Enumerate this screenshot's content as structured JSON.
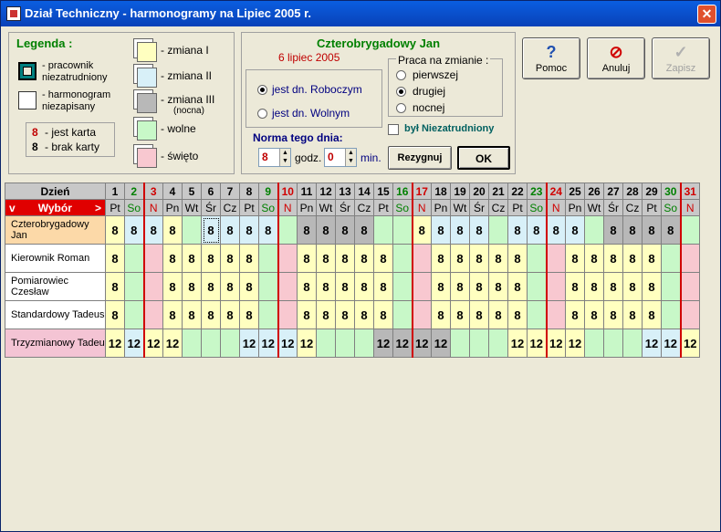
{
  "window": {
    "title": "Dział Techniczny - harmonogramy na Lipiec 2005 r."
  },
  "legend": {
    "title": "Legenda :",
    "employed_lbl1": "- pracownik",
    "employed_lbl2": "niezatrudniony",
    "unsched_lbl1": "- harmonogram",
    "unsched_lbl2": "niezapisany",
    "card_yes_num": "8",
    "card_yes_txt": "- jest karta",
    "card_no_num": "8",
    "card_no_txt": "- brak karty",
    "shift1": "- zmiana I",
    "shift2": "- zmiana II",
    "shift3": "- zmiana III",
    "shift3_sub": "(nocna)",
    "free": "- wolne",
    "holiday": "- święto"
  },
  "detail": {
    "name": "Czterobrygadowy Jan",
    "date": "6 lipiec 2005",
    "day_work": "jest dn. Roboczym",
    "day_free": "jest dn. Wolnym",
    "shift_group": "Praca na zmianie :",
    "shift_first": "pierwszej",
    "shift_second": "drugiej",
    "shift_night": "nocnej",
    "norm_label": "Norma tego dnia:",
    "hours_val": "8",
    "hours_lbl": "godz.",
    "min_val": "0",
    "min_lbl": "min.",
    "unemployed_lbl": "był Niezatrudniony",
    "cancel_btn": "Rezygnuj",
    "ok_btn": "OK"
  },
  "buttons": {
    "help": "Pomoc",
    "cancel": "Anuluj",
    "save": "Zapisz"
  },
  "grid": {
    "hdr_day": "Dzień",
    "hdr_select": "Wybór",
    "days": [
      {
        "n": "1",
        "d": "Pt",
        "t": "w"
      },
      {
        "n": "2",
        "d": "So",
        "t": "s"
      },
      {
        "n": "3",
        "d": "N",
        "t": "n"
      },
      {
        "n": "4",
        "d": "Pn",
        "t": "w"
      },
      {
        "n": "5",
        "d": "Wt",
        "t": "w"
      },
      {
        "n": "6",
        "d": "Śr",
        "t": "w"
      },
      {
        "n": "7",
        "d": "Cz",
        "t": "w"
      },
      {
        "n": "8",
        "d": "Pt",
        "t": "w"
      },
      {
        "n": "9",
        "d": "So",
        "t": "s"
      },
      {
        "n": "10",
        "d": "N",
        "t": "n"
      },
      {
        "n": "11",
        "d": "Pn",
        "t": "w"
      },
      {
        "n": "12",
        "d": "Wt",
        "t": "w"
      },
      {
        "n": "13",
        "d": "Śr",
        "t": "w"
      },
      {
        "n": "14",
        "d": "Cz",
        "t": "w"
      },
      {
        "n": "15",
        "d": "Pt",
        "t": "w"
      },
      {
        "n": "16",
        "d": "So",
        "t": "s"
      },
      {
        "n": "17",
        "d": "N",
        "t": "n"
      },
      {
        "n": "18",
        "d": "Pn",
        "t": "w"
      },
      {
        "n": "19",
        "d": "Wt",
        "t": "w"
      },
      {
        "n": "20",
        "d": "Śr",
        "t": "w"
      },
      {
        "n": "21",
        "d": "Cz",
        "t": "w"
      },
      {
        "n": "22",
        "d": "Pt",
        "t": "w"
      },
      {
        "n": "23",
        "d": "So",
        "t": "s"
      },
      {
        "n": "24",
        "d": "N",
        "t": "n"
      },
      {
        "n": "25",
        "d": "Pn",
        "t": "w"
      },
      {
        "n": "26",
        "d": "Wt",
        "t": "w"
      },
      {
        "n": "27",
        "d": "Śr",
        "t": "w"
      },
      {
        "n": "28",
        "d": "Cz",
        "t": "w"
      },
      {
        "n": "29",
        "d": "Pt",
        "t": "w"
      },
      {
        "n": "30",
        "d": "So",
        "t": "s"
      },
      {
        "n": "31",
        "d": "N",
        "t": "n"
      }
    ],
    "rows": [
      {
        "name": "Czterobrygadowy Jan",
        "bg": "#fcd9a8",
        "cells": [
          "8:y",
          "8:b",
          "8:b",
          "8:y",
          "f:g",
          "8:s",
          "8:b",
          "8:b",
          "8:b",
          "f:g",
          "8:d",
          "8:d",
          "8:d",
          "8:d",
          "f:g",
          "f:g",
          "8:y",
          "8:b",
          "8:b",
          "8:b",
          "f:g",
          "8:b",
          "8:b",
          "8:b",
          "8:b",
          "f:g",
          "8:d",
          "8:d",
          "8:d",
          "8:d",
          "f:g"
        ]
      },
      {
        "name": "Kierownik Roman",
        "bg": "#ffffff",
        "cells": [
          "8:y",
          "f:g",
          "f:p",
          "8:y",
          "8:y",
          "8:y",
          "8:y",
          "8:y",
          "f:g",
          "f:p",
          "8:y",
          "8:y",
          "8:y",
          "8:y",
          "8:y",
          "f:g",
          "f:p",
          "8:y",
          "8:y",
          "8:y",
          "8:y",
          "8:y",
          "f:g",
          "f:p",
          "8:y",
          "8:y",
          "8:y",
          "8:y",
          "8:y",
          "f:g",
          "f:p"
        ]
      },
      {
        "name": "Pomiarowiec Czesław",
        "bg": "#ffffff",
        "cells": [
          "8:y",
          "f:g",
          "f:p",
          "8:y",
          "8:y",
          "8:y",
          "8:y",
          "8:y",
          "f:g",
          "f:p",
          "8:y",
          "8:y",
          "8:y",
          "8:y",
          "8:y",
          "f:g",
          "f:p",
          "8:y",
          "8:y",
          "8:y",
          "8:y",
          "8:y",
          "f:g",
          "f:p",
          "8:y",
          "8:y",
          "8:y",
          "8:y",
          "8:y",
          "f:g",
          "f:p"
        ]
      },
      {
        "name": "Standardowy Tadeus",
        "bg": "#ffffff",
        "cells": [
          "8:y",
          "f:g",
          "f:p",
          "8:y",
          "8:y",
          "8:y",
          "8:y",
          "8:y",
          "f:g",
          "f:p",
          "8:y",
          "8:y",
          "8:y",
          "8:y",
          "8:y",
          "f:g",
          "f:p",
          "8:y",
          "8:y",
          "8:y",
          "8:y",
          "8:y",
          "f:g",
          "f:p",
          "8:y",
          "8:y",
          "8:y",
          "8:y",
          "8:y",
          "f:g",
          "f:p"
        ]
      },
      {
        "name": "Trzyzmianowy Tadeu",
        "bg": "#f4c4d4",
        "cells": [
          "12:y",
          "12:b",
          "12:y",
          "12:y",
          "f:g",
          "f:g",
          "f:g",
          "12:b",
          "12:b",
          "12:b",
          "12:y",
          "f:g",
          "f:g",
          "f:g",
          "12:d",
          "12:d",
          "12:d",
          "12:d",
          "f:g",
          "f:g",
          "f:g",
          "12:y",
          "12:y",
          "12:y",
          "12:y",
          "f:g",
          "f:g",
          "f:g",
          "12:b",
          "12:b",
          "12:y"
        ]
      }
    ]
  },
  "colors": {
    "y": "#ffffc0",
    "b": "#d8f0f8",
    "d": "#b8b8b8",
    "g": "#c8f8c8",
    "p": "#f8c8d0",
    "weekend": "#008000",
    "sunday": "#d00000"
  }
}
